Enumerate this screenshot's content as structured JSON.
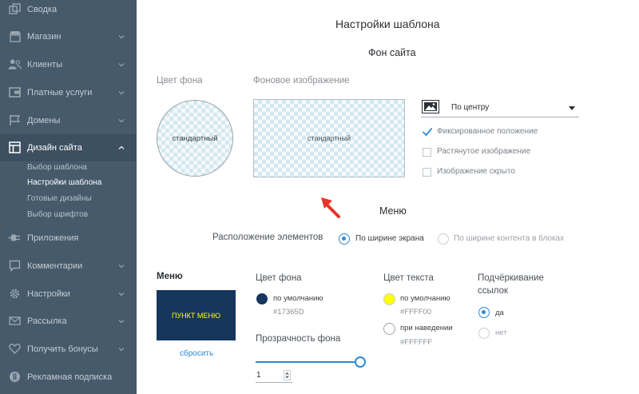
{
  "sidebar": {
    "items": [
      {
        "label": "Сводка",
        "icon": "squares-icon",
        "has_chevron": false
      },
      {
        "label": "Магазин",
        "icon": "store-icon",
        "has_chevron": true
      },
      {
        "label": "Клиенты",
        "icon": "users-icon",
        "has_chevron": true
      },
      {
        "label": "Платные услуги",
        "icon": "wallet-icon",
        "has_chevron": true
      },
      {
        "label": "Домены",
        "icon": "flag-icon",
        "has_chevron": true
      },
      {
        "label": "Дизайн сайта",
        "icon": "layout-icon",
        "has_chevron": true,
        "expanded": true
      },
      {
        "label": "Приложения",
        "icon": "plug-icon",
        "has_chevron": false
      },
      {
        "label": "Комментарии",
        "icon": "comment-icon",
        "has_chevron": true
      },
      {
        "label": "Настройки",
        "icon": "gear-icon",
        "has_chevron": true
      },
      {
        "label": "Рассылка",
        "icon": "mail-icon",
        "has_chevron": true
      },
      {
        "label": "Получить бонусы",
        "icon": "heart-icon",
        "has_chevron": true
      },
      {
        "label": "Рекламная подписка",
        "icon": "yandex-icon",
        "has_chevron": false
      }
    ],
    "design_subitems": [
      "Выбор шаблона",
      "Настройки шаблона",
      "Готовые дизайны",
      "Выбор шрифтов"
    ],
    "current_subitem": "Настройки шаблона"
  },
  "page": {
    "title": "Настройки шаблона",
    "background_section": {
      "title": "Фон сайта",
      "bg_color_label": "Цвет фона",
      "bg_color_value": "стандартный",
      "bg_image_label": "Фоновое изображение",
      "bg_image_value": "стандартный",
      "position_select": "По центру",
      "options": [
        {
          "label": "Фиксированное положение",
          "checked": true
        },
        {
          "label": "Растянутое изображение",
          "checked": false
        },
        {
          "label": "Изображение скрыто",
          "checked": false
        }
      ]
    },
    "menu_section": {
      "title": "Меню",
      "layout_label": "Расположение элементов",
      "layout_options": [
        {
          "label": "По ширине экрана",
          "selected": true
        },
        {
          "label": "По ширине контента в блоках",
          "selected": false
        }
      ],
      "preview_title": "Меню",
      "preview_item": "ПУНКТ МЕНЮ",
      "reset_link": "сбросить",
      "bg_color": {
        "label": "Цвет фона",
        "default_label": "по умолчанию",
        "value": "#17365D"
      },
      "opacity": {
        "label": "Прозрачность фона",
        "value": "1",
        "level": 1
      },
      "text_color": {
        "label": "Цвет текста",
        "default_label": "по умолчанию",
        "default_value": "#FFFF00",
        "hover_label": "при наведении",
        "hover_value": "#FFFFFF"
      },
      "underline": {
        "label_line1": "Подчёркивание",
        "label_line2": "ссылок",
        "options": [
          {
            "label": "да",
            "selected": true
          },
          {
            "label": "нет",
            "selected": false
          }
        ]
      }
    }
  },
  "colors": {
    "sidebar_bg": "#465a6b",
    "accent": "#2b8ad6",
    "menu_preview_bg": "#17365d",
    "menu_text": "#ffff00"
  }
}
